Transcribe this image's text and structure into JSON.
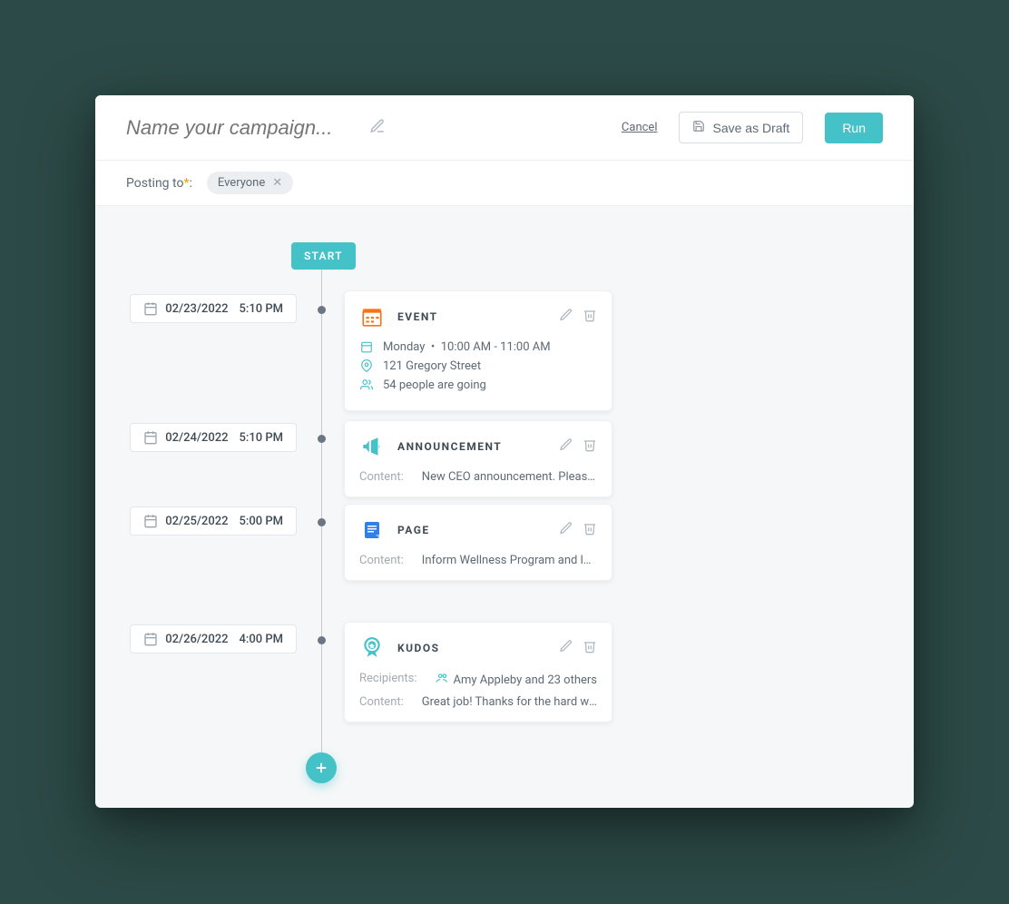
{
  "header": {
    "title_placeholder": "Name your campaign...",
    "cancel": "Cancel",
    "save_draft": "Save as Draft",
    "run": "Run"
  },
  "posting": {
    "label": "Posting to",
    "chip": "Everyone"
  },
  "timeline": {
    "start_label": "START",
    "content_label": "Content:",
    "recipients_label": "Recipients:",
    "nodes": [
      {
        "date": "02/23/2022",
        "time": "5:10 PM",
        "card": {
          "type": "EVENT",
          "day": "Monday",
          "time_range": "10:00 AM - 11:00 AM",
          "location": "121 Gregory Street",
          "attendees": "54 people are going"
        }
      },
      {
        "date": "02/24/2022",
        "time": "5:10 PM",
        "card": {
          "type": "ANNOUNCEMENT",
          "content": "New CEO announcement. Please eve..."
        }
      },
      {
        "date": "02/25/2022",
        "time": "5:00 PM",
        "card": {
          "type": "PAGE",
          "content": "Inform Wellness Program and long po..."
        }
      },
      {
        "date": "02/26/2022",
        "time": "4:00 PM",
        "card": {
          "type": "KUDOS",
          "recipients": "Amy Appleby and 23 others",
          "content": "Great job! Thanks for the hard work y..."
        }
      }
    ]
  }
}
